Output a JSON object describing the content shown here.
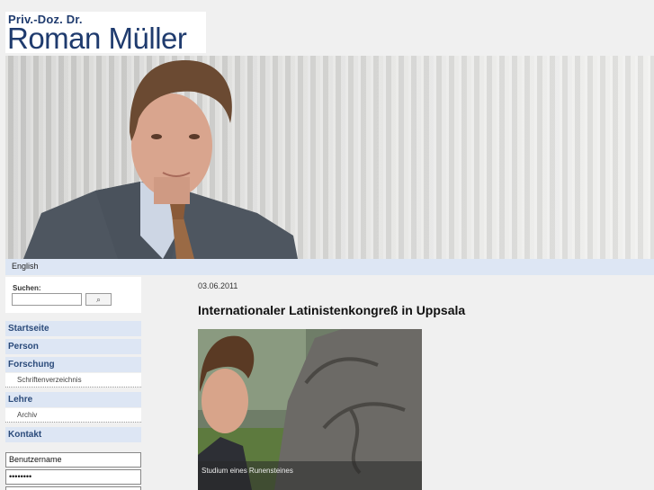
{
  "header": {
    "prefix": "Priv.-Doz. Dr.",
    "name": "Roman Müller"
  },
  "language": {
    "label": "English"
  },
  "search": {
    "label": "Suchen:",
    "value": "",
    "button_icon": "search-icon"
  },
  "nav": {
    "items": [
      {
        "label": "Startseite"
      },
      {
        "label": "Person"
      },
      {
        "label": "Forschung"
      },
      {
        "label": "Lehre"
      },
      {
        "label": "Kontakt"
      }
    ],
    "subitems": [
      {
        "label": "Schriftenverzeichnis"
      },
      {
        "label": "Archiv"
      }
    ]
  },
  "login": {
    "username_value": "Benutzername",
    "password_value": "••••••••"
  },
  "article": {
    "date": "03.06.2011",
    "title": "Internationaler Latinistenkongreß in Uppsala",
    "image_caption": "Studium eines Runensteines"
  },
  "colors": {
    "brand": "#1f3b6e",
    "navbg": "#dde6f4",
    "page": "#f0f0f0"
  }
}
